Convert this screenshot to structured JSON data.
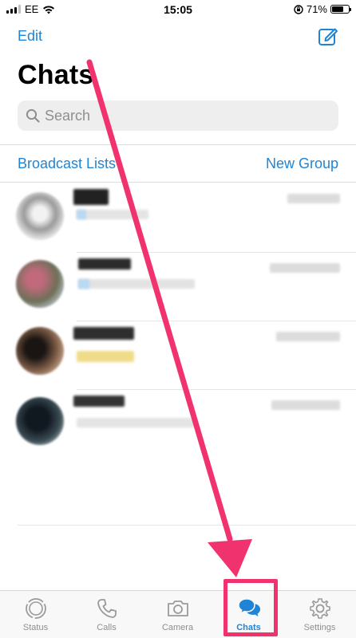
{
  "status_bar": {
    "carrier": "EE",
    "time": "15:05",
    "battery": "71%",
    "battery_level": 0.71
  },
  "header": {
    "edit_label": "Edit",
    "compose_icon": "compose-icon",
    "title": "Chats"
  },
  "search": {
    "placeholder": "Search",
    "icon": "search-icon"
  },
  "actions": {
    "broadcast_label": "Broadcast Lists",
    "new_group_label": "New Group"
  },
  "chats": {
    "count": 4,
    "note": "contact names and messages are pixelated"
  },
  "tabbar": {
    "tabs": [
      {
        "label": "Status",
        "icon": "status-icon",
        "active": false
      },
      {
        "label": "Calls",
        "icon": "phone-icon",
        "active": false
      },
      {
        "label": "Camera",
        "icon": "camera-icon",
        "active": false
      },
      {
        "label": "Chats",
        "icon": "chats-icon",
        "active": true
      },
      {
        "label": "Settings",
        "icon": "gear-icon",
        "active": false
      }
    ]
  },
  "colors": {
    "accent": "#1f84d6",
    "annotation": "#f0336f"
  }
}
